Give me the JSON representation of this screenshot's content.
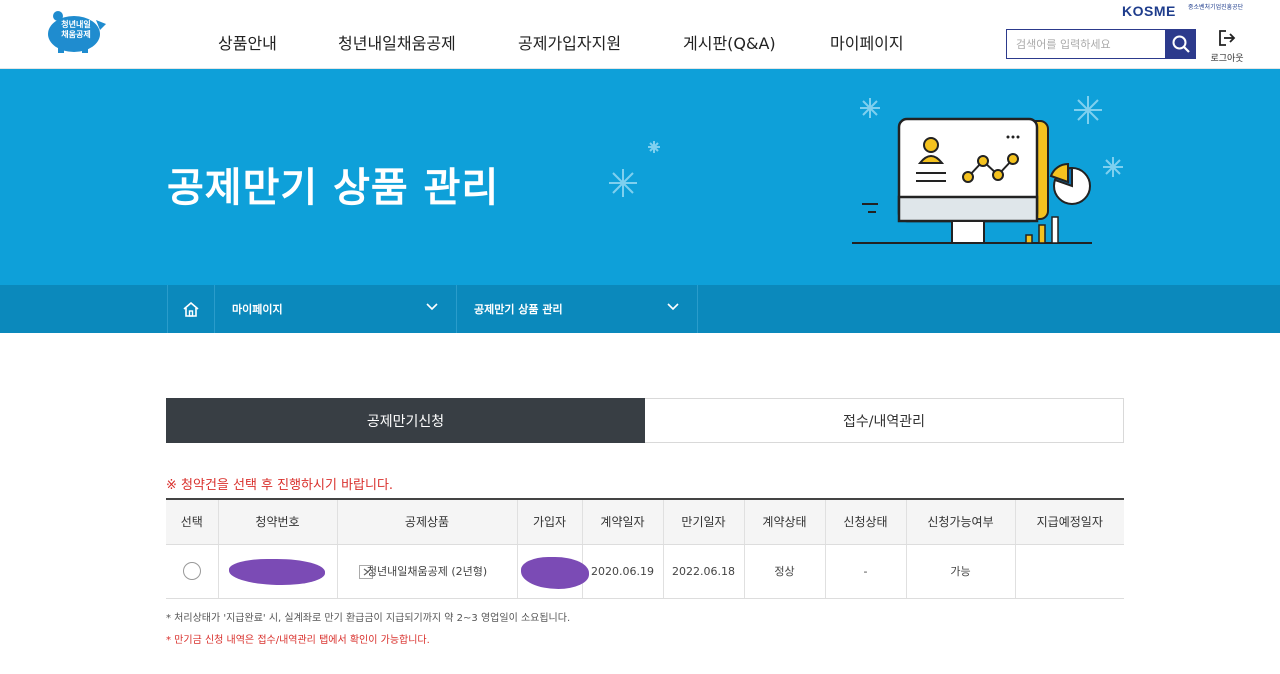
{
  "header": {
    "logo_text_line1": "청년내일",
    "logo_text_line2": "채움공제",
    "nav": [
      {
        "label": "상품안내"
      },
      {
        "label": "청년내일채움공제"
      },
      {
        "label": "공제가입자지원"
      },
      {
        "label": "게시판(Q&A)"
      },
      {
        "label": "마이페이지"
      }
    ],
    "kosme_logo": "KOSME",
    "kosme_sub": "중소벤처기업진흥공단",
    "search_placeholder": "검색어를 입력하세요",
    "logout_label": "로그아웃"
  },
  "banner": {
    "title": "공제만기 상품 관리"
  },
  "breadcrumb": {
    "items": [
      {
        "label": "마이페이지"
      },
      {
        "label": "공제만기 상품 관리"
      }
    ]
  },
  "tabs": [
    {
      "label": "공제만기신청",
      "active": true
    },
    {
      "label": "접수/내역관리",
      "active": false
    }
  ],
  "notice": "※ 청약건을 선택 후 진행하시기 바랍니다.",
  "table": {
    "headers": [
      "선택",
      "청약번호",
      "공제상품",
      "가입자",
      "계약일자",
      "만기일자",
      "계약상태",
      "신청상태",
      "신청가능여부",
      "지급예정일자"
    ],
    "rows": [
      {
        "product": "청년내일채움공제 (2년형)",
        "contract_date": "2020.06.19",
        "maturity_date": "2022.06.18",
        "contract_status": "정상",
        "apply_status": "-",
        "apply_possible": "가능",
        "payment_date": ""
      }
    ]
  },
  "footnotes": {
    "note1": "* 처리상태가 '지급완료' 시, 실계좌로 만기 환급금이 지급되기까지 약 2~3 영업일이 소요됩니다.",
    "note2": "* 만기금 신청 내역은 접수/내역관리 탭에서 확인이 가능합니다."
  },
  "colors": {
    "banner": "#0ea0d9",
    "breadcrumb": "#0b89bc",
    "tab_active": "#383e44",
    "accent_red": "#d9302c",
    "search_border": "#2c3a8c"
  }
}
